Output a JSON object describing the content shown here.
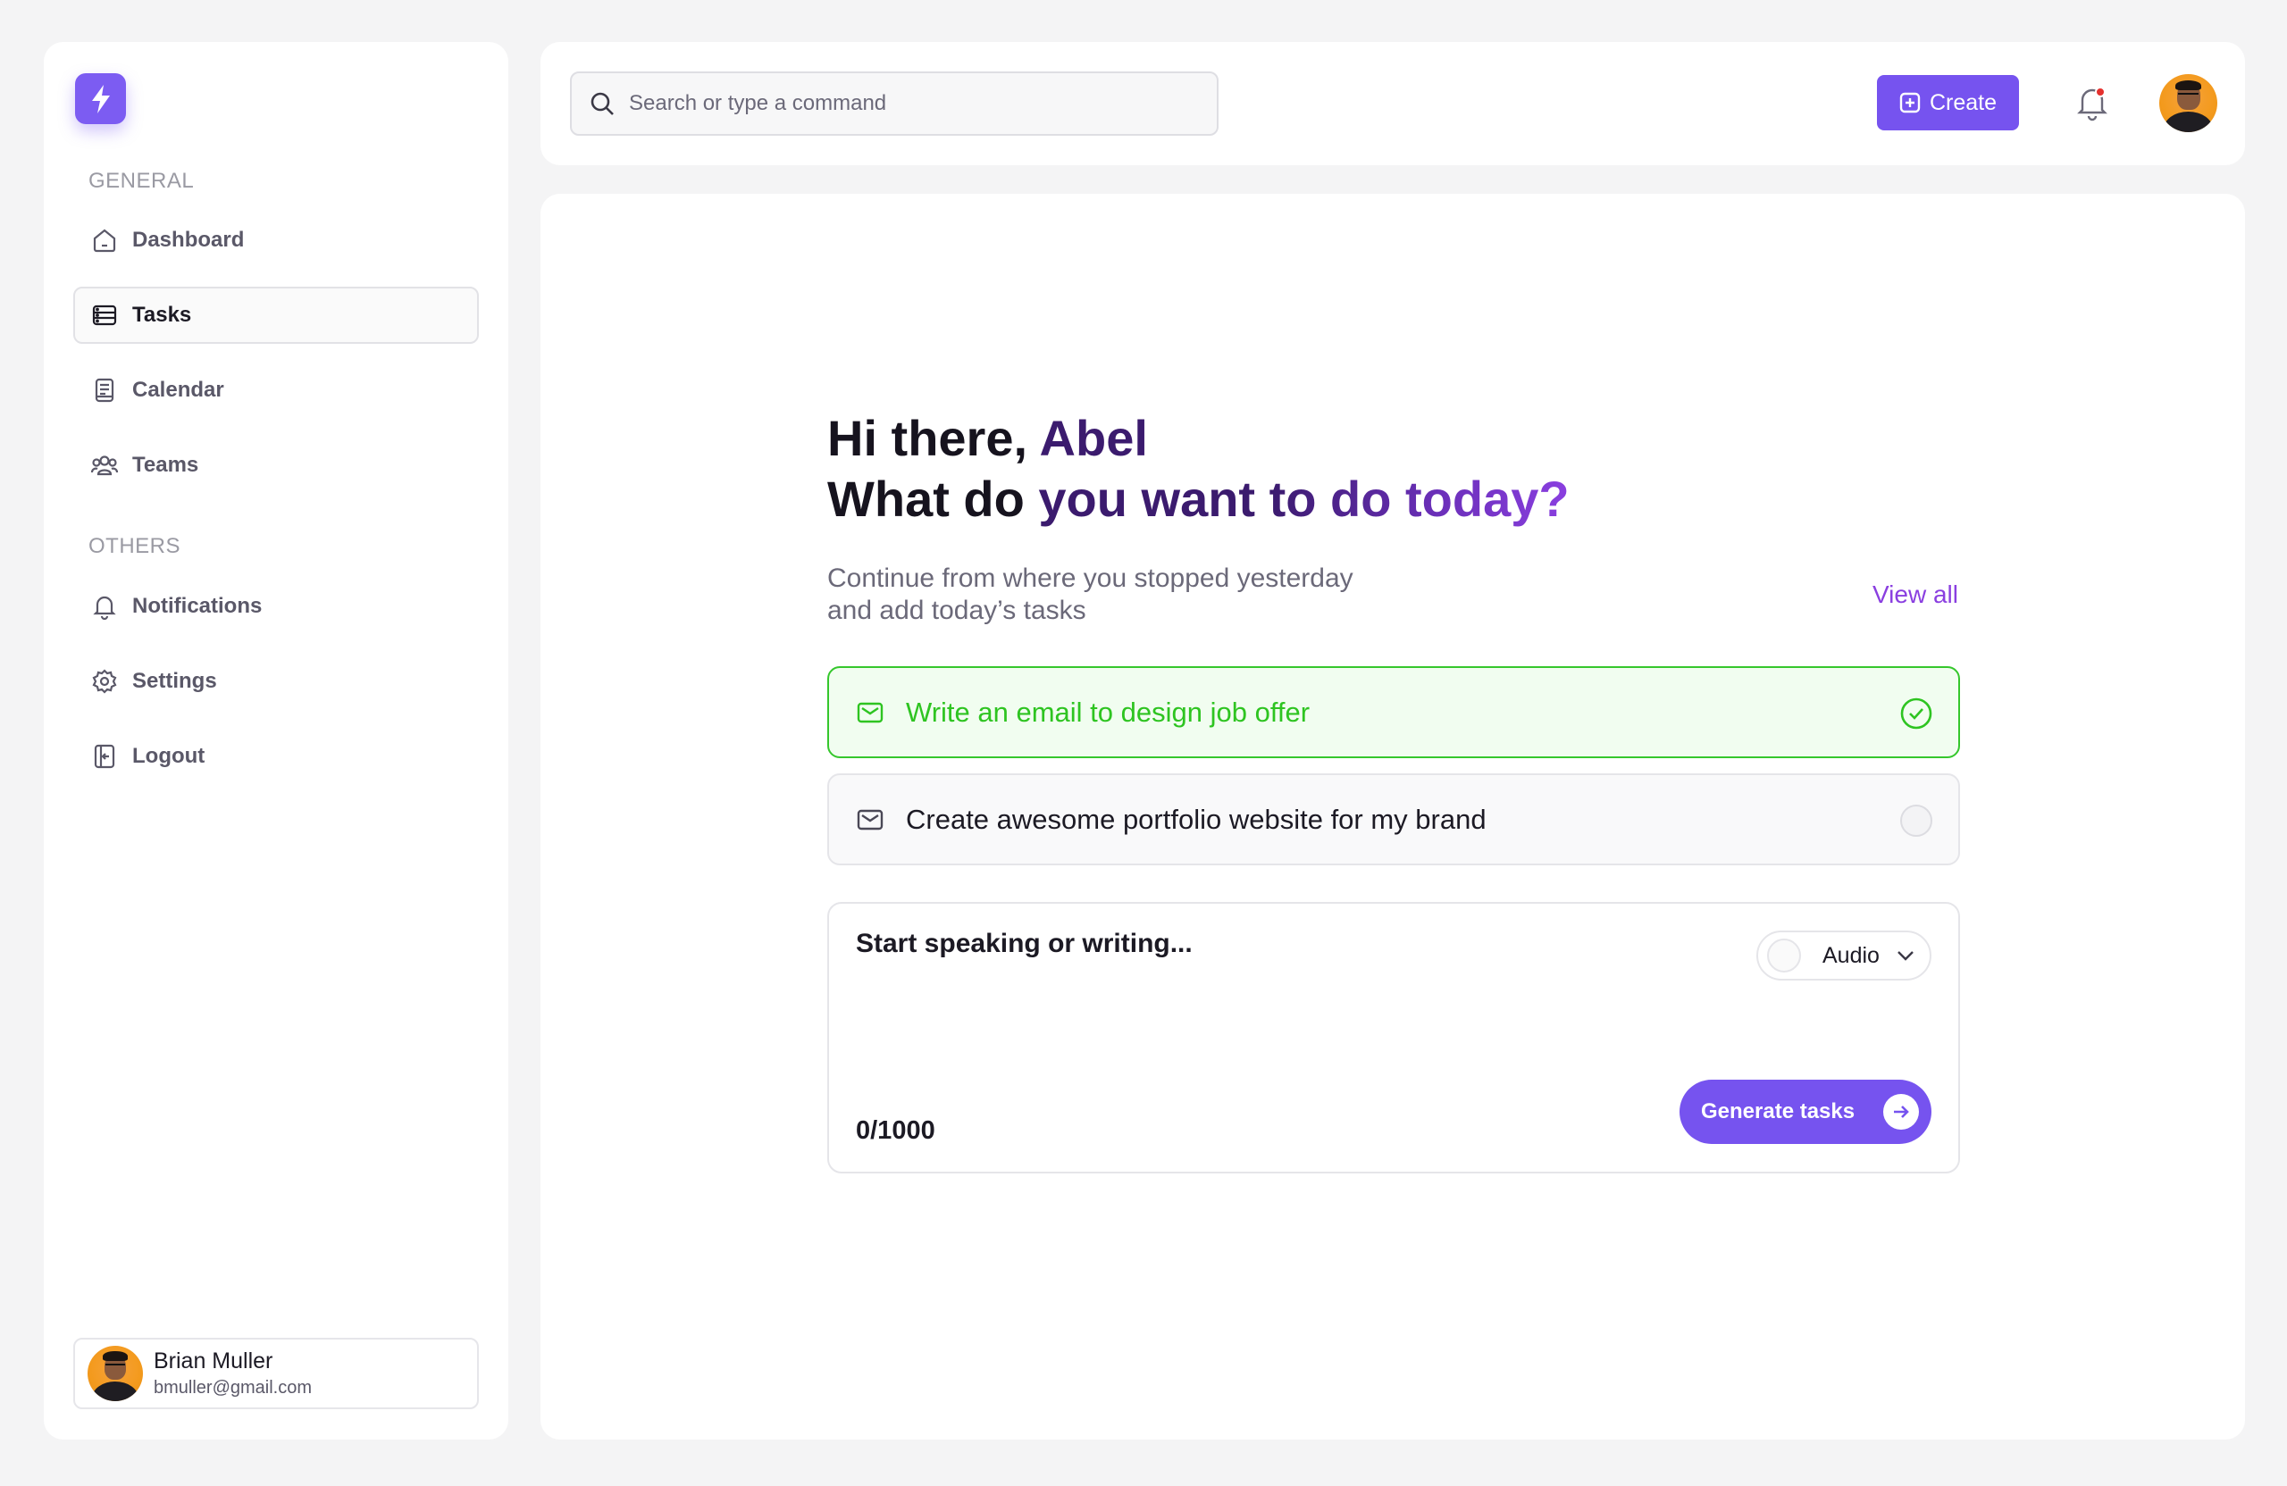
{
  "brand": {
    "logo_icon": "lightning-bolt-icon",
    "accent": "#7653ef"
  },
  "sidebar": {
    "general_title": "GENERAL",
    "others_title": "OTHERS",
    "items": [
      {
        "label": "Dashboard",
        "icon": "home-icon"
      },
      {
        "label": "Tasks",
        "icon": "tasks-icon",
        "active": true
      },
      {
        "label": "Calendar",
        "icon": "calendar-icon"
      },
      {
        "label": "Teams",
        "icon": "teams-icon"
      },
      {
        "label": "Notifications",
        "icon": "bell-icon"
      },
      {
        "label": "Settings",
        "icon": "gear-icon"
      },
      {
        "label": "Logout",
        "icon": "logout-icon"
      }
    ],
    "user": {
      "name": "Brian Muller",
      "email": "bmuller@gmail.com"
    }
  },
  "topbar": {
    "search_placeholder": "Search or type a command",
    "create_label": "Create",
    "notification_dot_color": "#e5312e"
  },
  "main": {
    "greeting_prefix": "Hi there, ",
    "greeting_name": "Abel",
    "question_part1": "What do ",
    "question_part2": "you want ",
    "question_part3": "to do today?",
    "subtitle_line1": "Continue from where you stopped yesterday",
    "subtitle_line2": "and add today’s tasks",
    "view_all": "View all",
    "tasks": [
      {
        "text": "Write an email to design job offer",
        "done": true
      },
      {
        "text": "Create awesome portfolio website for my brand",
        "done": false
      }
    ],
    "composer": {
      "prompt": "Start speaking or writing...",
      "mode_label": "Audio",
      "counter": "0/1000",
      "generate_label": "Generate tasks"
    }
  }
}
